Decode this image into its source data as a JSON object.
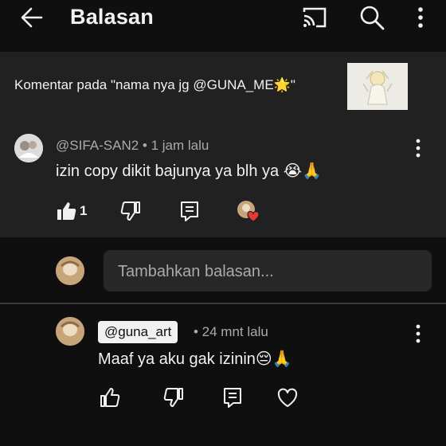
{
  "header": {
    "title": "Balasan",
    "icons": [
      "back-arrow-icon",
      "cast-icon",
      "search-icon",
      "more-vert-icon"
    ]
  },
  "context": {
    "text": "Komentar pada \"nama nya jg @GUNA_ME🌟\""
  },
  "comment": {
    "meta": "@SIFA-SAN2 • 1 jam lalu",
    "body": "izin copy dikit bajunya ya blh ya 😭🙏",
    "like_count": "1"
  },
  "add_reply": {
    "placeholder": "Tambahkan balasan..."
  },
  "reply": {
    "handle": "@guna_art",
    "time": "• 24 mnt lalu",
    "body": "Maaf ya aku gak izinin😔🙏"
  },
  "colors": {
    "background": "#0f0f0f",
    "surface": "#212121",
    "text": "#f1f1f1",
    "secondary_text": "#aaaaaa",
    "heart": "#e53935"
  }
}
